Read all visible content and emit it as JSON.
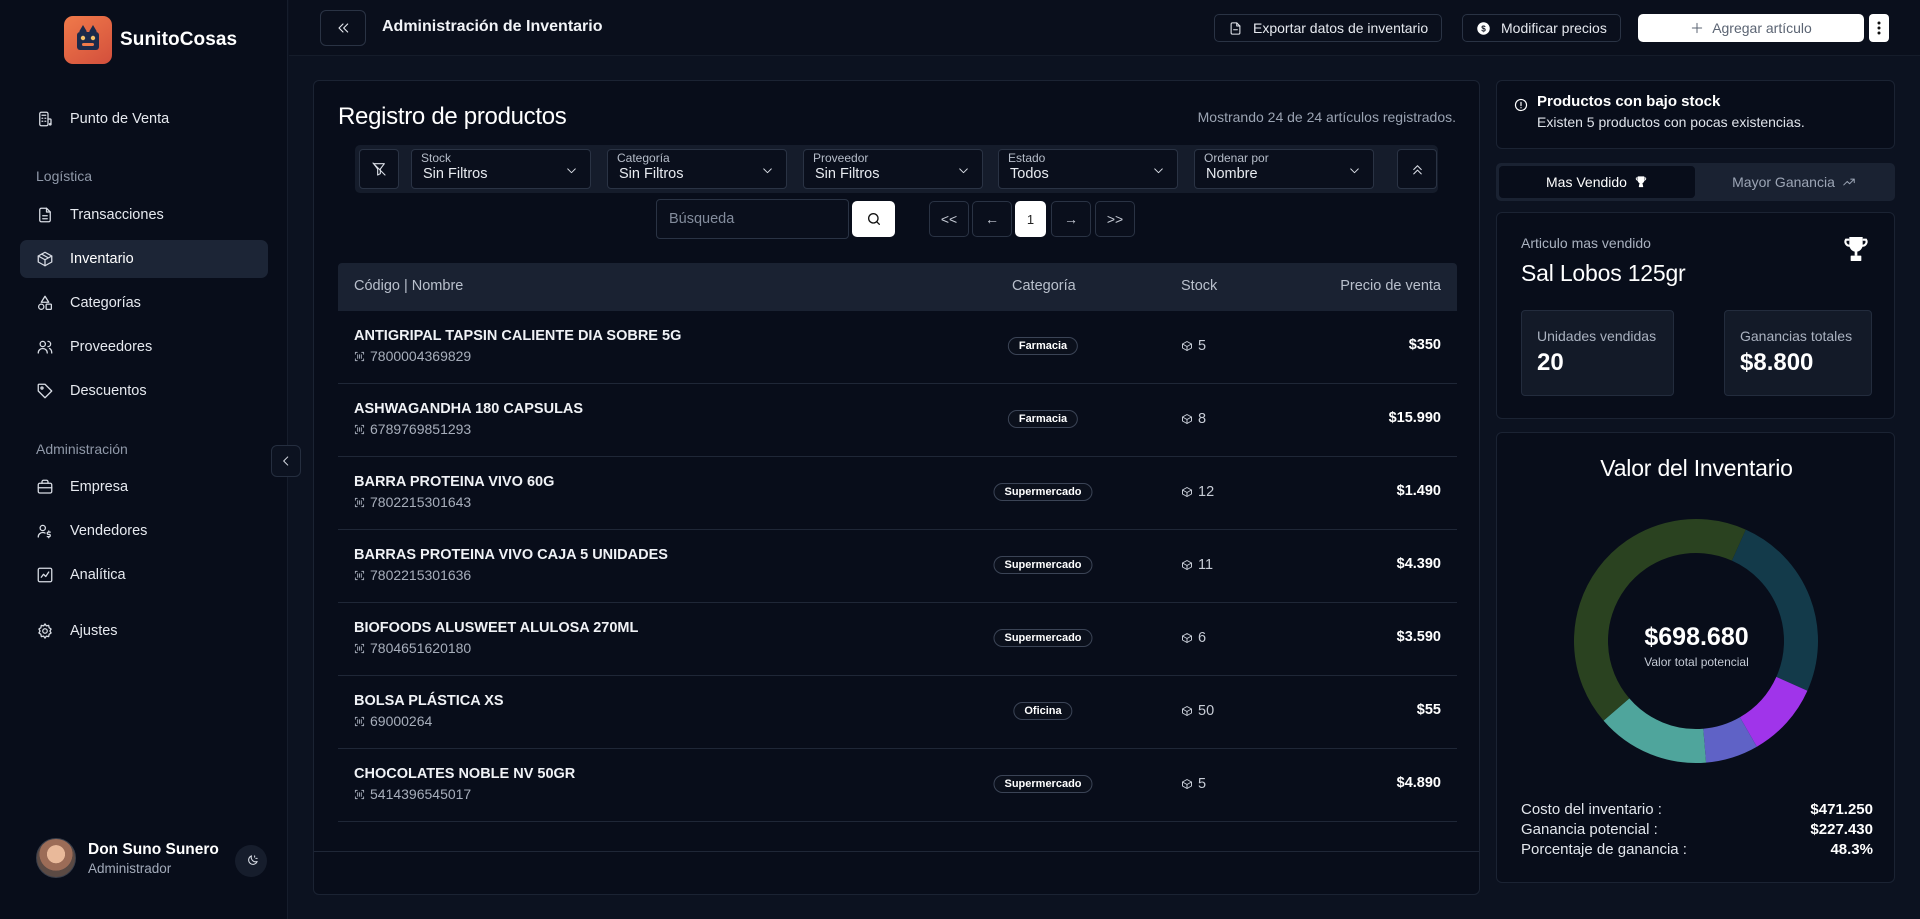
{
  "app": {
    "name": "SunitoCosas"
  },
  "sidebar": {
    "pos": "Punto de Venta",
    "section_logistica": "Logística",
    "logistica": [
      "Transacciones",
      "Inventario",
      "Categorías",
      "Proveedores",
      "Descuentos"
    ],
    "section_admin": "Administración",
    "admin": [
      "Empresa",
      "Vendedores",
      "Analítica"
    ],
    "settings": "Ajustes",
    "user": {
      "name": "Don Suno Sunero",
      "role": "Administrador"
    }
  },
  "topbar": {
    "title": "Administración de Inventario",
    "export_label": "Exportar datos de inventario",
    "prices_label": "Modificar precios",
    "add_label": "Agregar artículo"
  },
  "main": {
    "title": "Registro de productos",
    "count_text": "Mostrando 24 de 24 artículos registrados.",
    "filters": [
      {
        "label": "Stock",
        "value": "Sin Filtros"
      },
      {
        "label": "Categoría",
        "value": "Sin Filtros"
      },
      {
        "label": "Proveedor",
        "value": "Sin Filtros"
      },
      {
        "label": "Estado",
        "value": "Todos"
      },
      {
        "label": "Ordenar por",
        "value": "Nombre"
      }
    ],
    "search_placeholder": "Búsqueda",
    "pagination": {
      "first": "<<",
      "prev": "←",
      "current": "1",
      "next": "→",
      "last": ">>"
    },
    "columns": {
      "name": "Código | Nombre",
      "category": "Categoría",
      "stock": "Stock",
      "price": "Precio de venta"
    },
    "rows": [
      {
        "name": "ANTIGRIPAL TAPSIN CALIENTE DIA SOBRE 5G",
        "code": "7800004369829",
        "category": "Farmacia",
        "stock": "5",
        "price": "$350"
      },
      {
        "name": "ASHWAGANDHA 180 CAPSULAS",
        "code": "6789769851293",
        "category": "Farmacia",
        "stock": "8",
        "price": "$15.990"
      },
      {
        "name": "BARRA PROTEINA VIVO 60G",
        "code": "7802215301643",
        "category": "Supermercado",
        "stock": "12",
        "price": "$1.490"
      },
      {
        "name": "BARRAS PROTEINA VIVO CAJA 5 UNIDADES",
        "code": "7802215301636",
        "category": "Supermercado",
        "stock": "11",
        "price": "$4.390"
      },
      {
        "name": "BIOFOODS ALUSWEET ALULOSA 270ML",
        "code": "7804651620180",
        "category": "Supermercado",
        "stock": "6",
        "price": "$3.590"
      },
      {
        "name": "BOLSA PLÁSTICA XS",
        "code": "69000264",
        "category": "Oficina",
        "stock": "50",
        "price": "$55"
      },
      {
        "name": "CHOCOLATES NOBLE NV 50GR",
        "code": "5414396545017",
        "category": "Supermercado",
        "stock": "5",
        "price": "$4.890"
      }
    ]
  },
  "alert": {
    "title": "Productos con bajo stock",
    "text": "Existen 5 productos con pocas existencias."
  },
  "tabs": {
    "best_seller": "Mas Vendido",
    "most_profit": "Mayor Ganancia",
    "active": "best_seller"
  },
  "best": {
    "label": "Articulo mas vendido",
    "name": "Sal Lobos 125gr",
    "units_label": "Unidades vendidas",
    "units_value": "20",
    "profit_label": "Ganancias totales",
    "profit_value": "$8.800"
  },
  "inventory_value": {
    "title": "Valor del Inventario",
    "total": "$698.680",
    "total_label": "Valor total potencial",
    "cost_label": "Costo del inventario :",
    "cost_value": "$471.250",
    "profit_label": "Ganancia potencial :",
    "profit_value": "$227.430",
    "percent_label": "Porcentaje de ganancia :",
    "percent_value": "48.3%",
    "segments": [
      {
        "color": "#133a4a",
        "value": 0.25
      },
      {
        "color": "#a034ea",
        "value": 0.1
      },
      {
        "color": "#5f62c6",
        "value": 0.07
      },
      {
        "color": "#4fa59c",
        "value": 0.15
      },
      {
        "color": "#2a4220",
        "value": 0.43
      }
    ]
  }
}
